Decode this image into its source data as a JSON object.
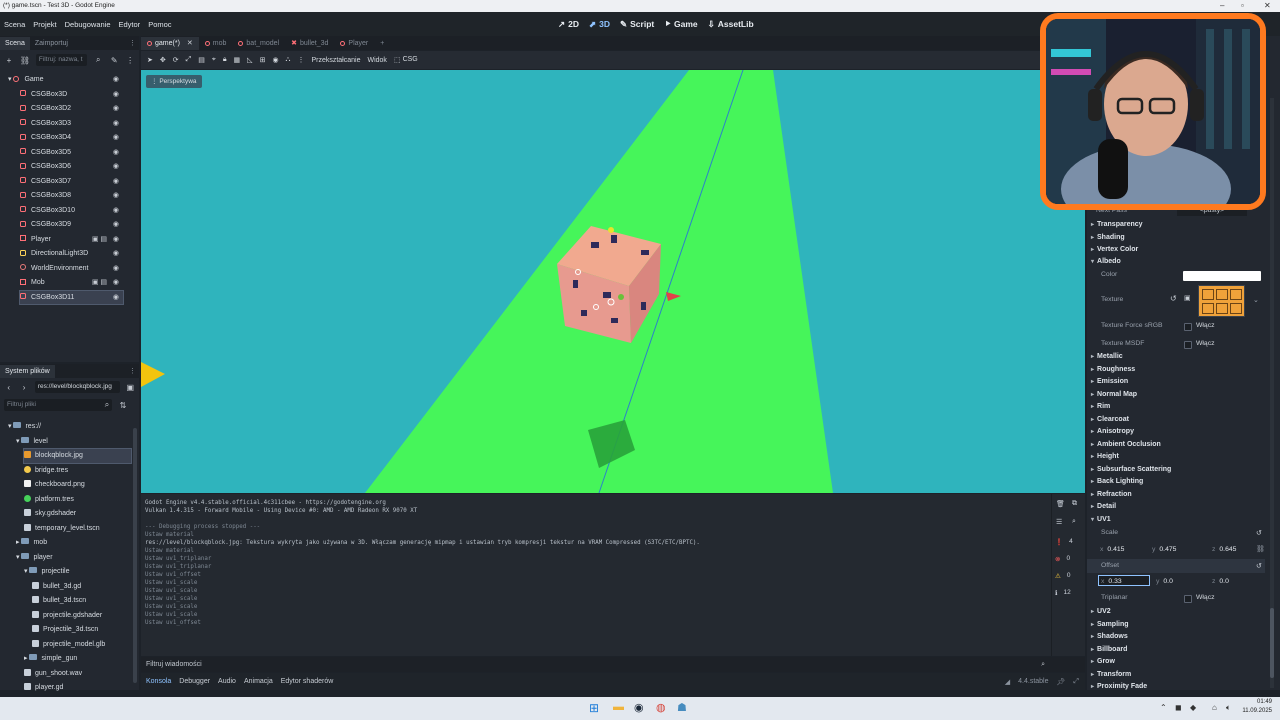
{
  "window": {
    "title": "(*) game.tscn - Test 3D - Godot Engine"
  },
  "menubar": {
    "menus": [
      "Scena",
      "Projekt",
      "Debugowanie",
      "Edytor",
      "Pomoc"
    ],
    "modes": [
      "2D",
      "3D",
      "Script",
      "Game",
      "AssetLib"
    ]
  },
  "scene_dock": {
    "tabs": [
      "Scena",
      "Zaimportuj"
    ],
    "filter_placeholder": "Filtruj: nazwa, t",
    "nodes": [
      {
        "label": "Game",
        "kind": "root"
      },
      {
        "label": "CSGBox3D",
        "kind": "csg"
      },
      {
        "label": "CSGBox3D2",
        "kind": "csg"
      },
      {
        "label": "CSGBox3D3",
        "kind": "csg"
      },
      {
        "label": "CSGBox3D4",
        "kind": "csg"
      },
      {
        "label": "CSGBox3D5",
        "kind": "csg"
      },
      {
        "label": "CSGBox3D6",
        "kind": "csg"
      },
      {
        "label": "CSGBox3D7",
        "kind": "csg"
      },
      {
        "label": "CSGBox3D8",
        "kind": "csg"
      },
      {
        "label": "CSGBox3D10",
        "kind": "csg"
      },
      {
        "label": "CSGBox3D9",
        "kind": "csg"
      },
      {
        "label": "Player",
        "kind": "scene"
      },
      {
        "label": "DirectionalLight3D",
        "kind": "light"
      },
      {
        "label": "WorldEnvironment",
        "kind": "env"
      },
      {
        "label": "Mob",
        "kind": "scene"
      },
      {
        "label": "CSGBox3D11",
        "kind": "csg",
        "selected": true
      }
    ]
  },
  "filesystem": {
    "title": "System plików",
    "path": "res://level/blockqblock.jpg",
    "filter_placeholder": "Filtruj pliki",
    "items": [
      {
        "label": "res://",
        "type": "folder",
        "depth": 0
      },
      {
        "label": "level",
        "type": "folder",
        "depth": 1
      },
      {
        "label": "blockqblock.jpg",
        "type": "image",
        "depth": 2,
        "selected": true
      },
      {
        "label": "bridge.tres",
        "type": "res",
        "depth": 2
      },
      {
        "label": "checkboard.png",
        "type": "image-white",
        "depth": 2
      },
      {
        "label": "platform.tres",
        "type": "res-green",
        "depth": 2
      },
      {
        "label": "sky.gdshader",
        "type": "shader",
        "depth": 2
      },
      {
        "label": "temporary_level.tscn",
        "type": "scene",
        "depth": 2
      },
      {
        "label": "mob",
        "type": "folder",
        "depth": 1
      },
      {
        "label": "player",
        "type": "folder",
        "depth": 1
      },
      {
        "label": "projectile",
        "type": "folder",
        "depth": 2
      },
      {
        "label": "bullet_3d.gd",
        "type": "script",
        "depth": 3
      },
      {
        "label": "bullet_3d.tscn",
        "type": "scene",
        "depth": 3
      },
      {
        "label": "projectile.gdshader",
        "type": "shader",
        "depth": 3
      },
      {
        "label": "Projectile_3d.tscn",
        "type": "scene",
        "depth": 3
      },
      {
        "label": "projectile_model.glb",
        "type": "scene",
        "depth": 3
      },
      {
        "label": "simple_gun",
        "type": "folder",
        "depth": 2
      },
      {
        "label": "gun_shoot.wav",
        "type": "audio",
        "depth": 2
      },
      {
        "label": "player.gd",
        "type": "script",
        "depth": 2
      }
    ]
  },
  "doc_tabs": [
    {
      "label": "game(*)",
      "active": true
    },
    {
      "label": "mob"
    },
    {
      "label": "bat_model"
    },
    {
      "label": "bullet_3d"
    },
    {
      "label": "Player"
    }
  ],
  "viewport_toolbar": {
    "transform_label": "Przekształcanie",
    "view_label": "Widok",
    "csg_label": "CSG",
    "perspective_label": "Perspektywa"
  },
  "output": {
    "lines": [
      {
        "text": "Godot Engine v4.4.stable.official.4c311cbee - https://godotengine.org",
        "dim": false
      },
      {
        "text": "Vulkan 1.4.315 - Forward Mobile - Using Device #0: AMD - AMD Radeon RX 9070 XT",
        "dim": false
      },
      {
        "text": "",
        "dim": false
      },
      {
        "text": "--- Debugging process stopped ---",
        "dim": true
      },
      {
        "text": "Ustaw material",
        "dim": true
      },
      {
        "text": "res://level/blockqblock.jpg: Tekstura wykryta jako używana w 3D. Włączam generację mipmap i ustawian tryb kompresji tekstur na VRAM Compressed (S3TC/ETC/BPTC).",
        "dim": false
      },
      {
        "text": "Ustaw material",
        "dim": true
      },
      {
        "text": "Ustaw uv1_triplanar",
        "dim": true
      },
      {
        "text": "Ustaw uv1_triplanar",
        "dim": true
      },
      {
        "text": "Ustaw uv1_offset",
        "dim": true
      },
      {
        "text": "Ustaw uv1_scale",
        "dim": true
      },
      {
        "text": "Ustaw uv1_scale",
        "dim": true
      },
      {
        "text": "Ustaw uv1_scale",
        "dim": true
      },
      {
        "text": "Ustaw uv1_scale",
        "dim": true
      },
      {
        "text": "Ustaw uv1_scale",
        "dim": true
      },
      {
        "text": "Ustaw uv1_offset",
        "dim": true
      }
    ],
    "counts": {
      "errors": "4",
      "error2": "0",
      "warnings": "0",
      "messages": "12"
    },
    "filter_placeholder": "Filtruj wiadomości"
  },
  "bottom_tabs": [
    "Konsola",
    "Debugger",
    "Audio",
    "Animacja",
    "Edytor shaderów"
  ],
  "version": "4.4.stable",
  "inspector": {
    "next_pass_label": "Next Pass",
    "next_pass_value": "<pusty>",
    "sections": [
      "Transparency",
      "Shading",
      "Vertex Color",
      "Albedo"
    ],
    "albedo": {
      "color_label": "Color",
      "texture_label": "Texture",
      "texture_force_srgb_label": "Texture Force sRGB",
      "texture_msdf_label": "Texture MSDF",
      "enable_label": "Włącz"
    },
    "sections2": [
      "Metallic",
      "Roughness",
      "Emission",
      "Normal Map",
      "Rim",
      "Clearcoat",
      "Anisotropy",
      "Ambient Occlusion",
      "Height",
      "Subsurface Scattering",
      "Back Lighting",
      "Refraction",
      "Detail",
      "UV1"
    ],
    "uv1": {
      "scale_label": "Scale",
      "scale": {
        "x": "0.415",
        "y": "0.475",
        "z": "0.645"
      },
      "offset_label": "Offset",
      "offset": {
        "x": "0.33",
        "y": "0.0",
        "z": "0.0"
      },
      "triplanar_label": "Triplanar",
      "enable_label": "Włącz"
    },
    "sections3": [
      "UV2",
      "Sampling",
      "Shadows",
      "Billboard",
      "Grow",
      "Transform",
      "Proximity Fade"
    ]
  },
  "taskbar": {
    "time": "01:49",
    "date": "11.09.2025"
  },
  "colors": {
    "viewport_sky": "#2fb4bd",
    "ground": "#46f55a",
    "accent": "#8fc3ff",
    "webcam_border": "#ff7a1f"
  }
}
